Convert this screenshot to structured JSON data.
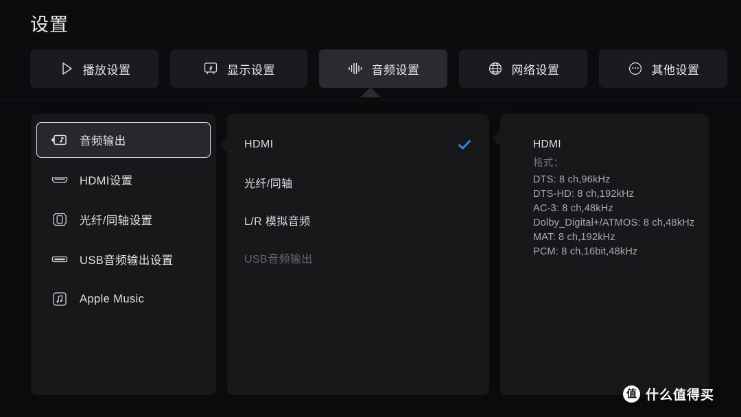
{
  "header": {
    "title": "设置",
    "tabs": [
      {
        "label": "播放设置",
        "icon": "play-icon",
        "selected": false
      },
      {
        "label": "显示设置",
        "icon": "display-icon",
        "selected": false
      },
      {
        "label": "音频设置",
        "icon": "waveform-icon",
        "selected": true
      },
      {
        "label": "网络设置",
        "icon": "globe-icon",
        "selected": false
      },
      {
        "label": "其他设置",
        "icon": "more-dots-icon",
        "selected": false
      }
    ]
  },
  "sidebar": {
    "items": [
      {
        "label": "音频输出",
        "icon": "audio-output-icon",
        "selected": true
      },
      {
        "label": "HDMI设置",
        "icon": "hdmi-port-icon",
        "selected": false
      },
      {
        "label": "光纤/同轴设置",
        "icon": "optical-port-icon",
        "selected": false
      },
      {
        "label": "USB音频输出设置",
        "icon": "usb-port-icon",
        "selected": false
      },
      {
        "label": "Apple Music",
        "icon": "music-note-icon",
        "selected": false
      }
    ]
  },
  "options": {
    "items": [
      {
        "label": "HDMI",
        "checked": true,
        "disabled": false
      },
      {
        "label": "光纤/同轴",
        "checked": false,
        "disabled": false
      },
      {
        "label": "L/R 模拟音频",
        "checked": false,
        "disabled": false
      },
      {
        "label": "USB音频输出",
        "checked": false,
        "disabled": true
      }
    ]
  },
  "detail": {
    "title": "HDMI",
    "subtitle": "格式：",
    "lines": [
      "DTS: 8 ch,96kHz",
      "DTS-HD: 8 ch,192kHz",
      "AC-3: 8 ch,48kHz",
      "Dolby_Digital+/ATMOS: 8 ch,48kHz",
      "MAT: 8 ch,192kHz",
      "PCM: 8 ch,16bit,48kHz"
    ]
  },
  "watermark": {
    "logo_char": "值",
    "text": "什么值得买"
  },
  "colors": {
    "accent_check": "#2b8df0",
    "panel_bg": "#17181a",
    "screen_bg": "#0a0b0d",
    "tab_bg": "#1a1b1e",
    "tab_selected_bg": "#2a2b2e"
  }
}
